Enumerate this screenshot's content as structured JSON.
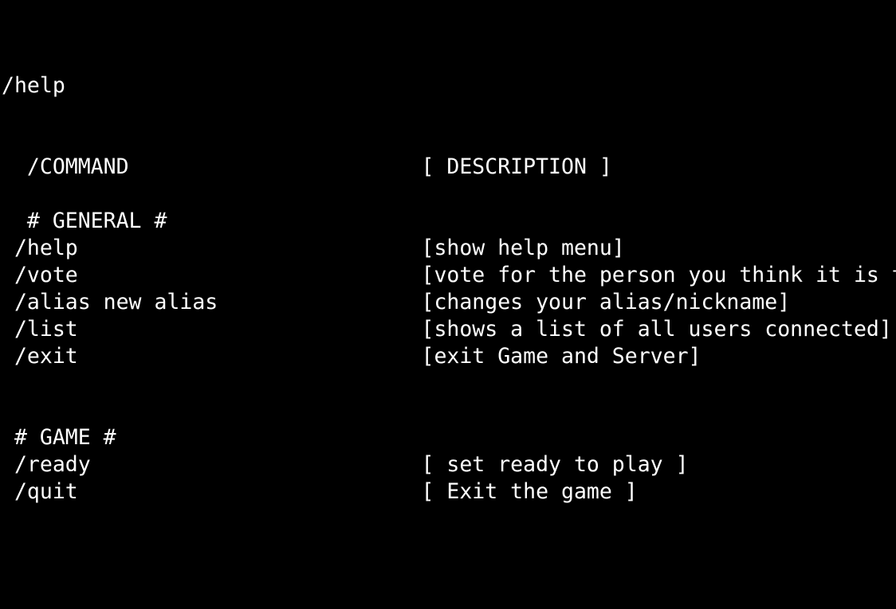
{
  "terminal": {
    "background": "#000000",
    "foreground": "#ffffff",
    "lines": [
      "/help",
      "",
      "",
      "  /COMMAND                       [ DESCRIPTION ]",
      "",
      "  # GENERAL #",
      " /help                           [show help menu]",
      " /vote                           [vote for the person you think it is the",
      " /alias new alias                [changes your alias/nickname]",
      " /list                           [shows a list of all users connected]",
      " /exit                           [exit Game and Server]",
      "",
      "",
      "",
      " # GAME #",
      " /ready                          [ set ready to play ]",
      " /quit                           [ Exit the game ]"
    ]
  }
}
